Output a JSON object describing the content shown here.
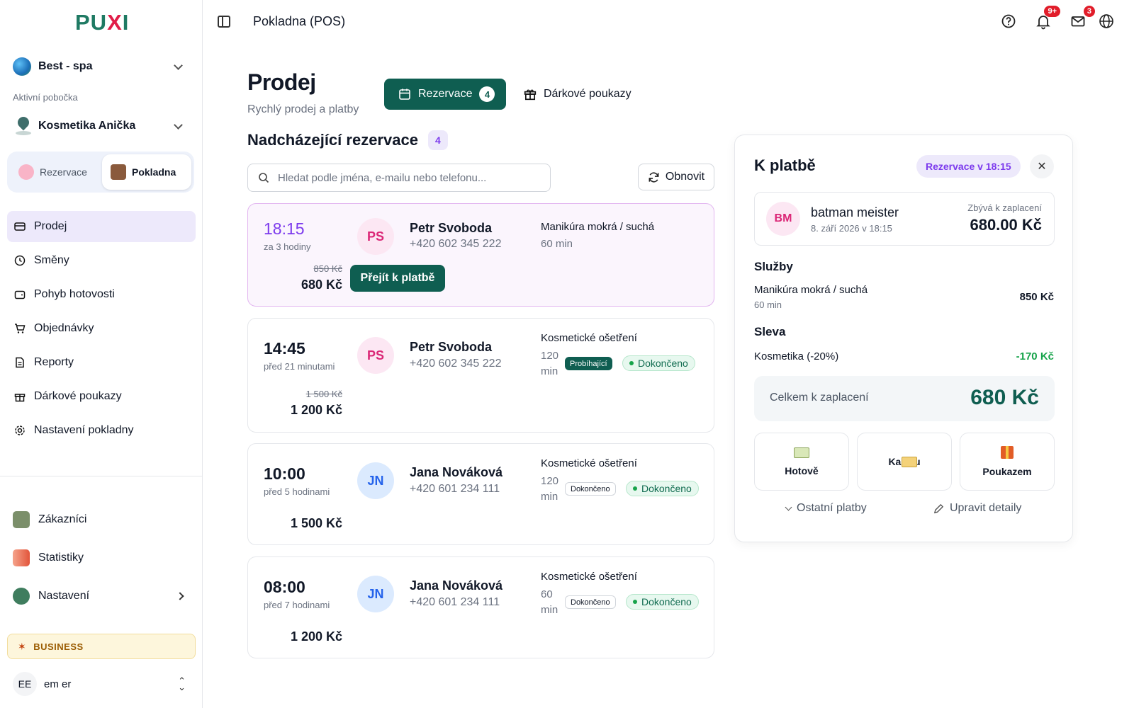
{
  "sidebar": {
    "logo": {
      "main": "PU",
      "accent": "X",
      "tail": "I"
    },
    "org": {
      "name": "Best - spa"
    },
    "branch": {
      "label": "Aktivní pobočka",
      "name": "Kosmetika Anička"
    },
    "segments": [
      {
        "label": "Rezervace",
        "icon": "calendar-icon",
        "active": false
      },
      {
        "label": "Pokladna",
        "icon": "wallet-icon",
        "active": true
      }
    ],
    "nav": [
      {
        "label": "Prodej",
        "icon": "card-icon",
        "active": true
      },
      {
        "label": "Směny",
        "icon": "clock-icon",
        "active": false
      },
      {
        "label": "Pohyb hotovosti",
        "icon": "wallet-icon",
        "active": false
      },
      {
        "label": "Objednávky",
        "icon": "cart-icon",
        "active": false
      },
      {
        "label": "Reporty",
        "icon": "document-icon",
        "active": false
      },
      {
        "label": "Dárkové poukazy",
        "icon": "gift-icon",
        "active": false
      },
      {
        "label": "Nastavení pokladny",
        "icon": "gear-icon",
        "active": false
      }
    ],
    "nav2": [
      {
        "label": "Zákazníci",
        "icon": "customers-icon"
      },
      {
        "label": "Statistiky",
        "icon": "chart-icon"
      },
      {
        "label": "Nastavení",
        "icon": "gear-icon"
      }
    ],
    "plan": "BUSINESS",
    "user": {
      "initials": "EE",
      "name": "em er"
    }
  },
  "topbar": {
    "title": "Pokladna (POS)",
    "notifications_badge": "9+",
    "messages_badge": "3"
  },
  "main": {
    "title": "Prodej",
    "subtitle": "Rychlý prodej a platby",
    "res_button": {
      "label": "Rezervace",
      "count": "4"
    },
    "gift_button": "Dárkové poukazy",
    "section": {
      "title": "Nadcházející rezervace",
      "count": "4"
    },
    "search_placeholder": "Hledat podle jména, e-mailu nebo telefonu...",
    "refresh_label": "Obnovit",
    "pay_button": "Přejít k platbě",
    "reservations": [
      {
        "time": "18:15",
        "relative": "za 3 hodiny",
        "old_price": "850 Kč",
        "price": "680 Kč",
        "initials": "PS",
        "name": "Petr Svoboda",
        "phone": "+420 602 345 222",
        "service": "Manikúra mokrá / suchá",
        "duration": "60 min",
        "state": "",
        "status": ""
      },
      {
        "time": "14:45",
        "relative": "před 21 minutami",
        "old_price": "1 500 Kč",
        "price": "1 200 Kč",
        "initials": "PS",
        "name": "Petr Svoboda",
        "phone": "+420 602 345 222",
        "service": "Kosmetické ošetření",
        "duration": "120 min",
        "state": "Probíhající",
        "status": "Dokončeno"
      },
      {
        "time": "10:00",
        "relative": "před 5 hodinami",
        "old_price": "",
        "price": "1 500 Kč",
        "initials": "JN",
        "name": "Jana Nováková",
        "phone": "+420 601 234 111",
        "service": "Kosmetické ošetření",
        "duration": "120 min",
        "state": "Dokončeno",
        "status": "Dokončeno"
      },
      {
        "time": "08:00",
        "relative": "před 7 hodinami",
        "old_price": "",
        "price": "1 200 Kč",
        "initials": "JN",
        "name": "Jana Nováková",
        "phone": "+420 601 234 111",
        "service": "Kosmetické ošetření",
        "duration": "60 min",
        "state": "Dokončeno",
        "status": "Dokončeno"
      }
    ]
  },
  "payment": {
    "title": "K platbě",
    "tag": "Rezervace v 18:15",
    "customer": {
      "initials": "BM",
      "name": "batman meister",
      "date": "8. září 2026 v 18:15",
      "left_label": "Zbývá k zaplacení",
      "left_value": "680.00 Kč"
    },
    "services_title": "Služby",
    "service": {
      "name": "Manikúra mokrá / suchá",
      "duration": "60 min",
      "price": "850 Kč"
    },
    "discount_title": "Sleva",
    "discount": {
      "name": "Kosmetika (-20%)",
      "value": "-170 Kč"
    },
    "total": {
      "label": "Celkem k zaplacení",
      "value": "680 Kč"
    },
    "methods": [
      "Hotově",
      "Kartou",
      "Poukazem"
    ],
    "other_payments": "Ostatní platby",
    "edit_details": "Upravit detaily"
  },
  "colors": {
    "primary": "#0f5e51",
    "accent_purple": "#7c3aed",
    "discount_green": "#16a34a",
    "badge_red": "#e11d2a"
  }
}
